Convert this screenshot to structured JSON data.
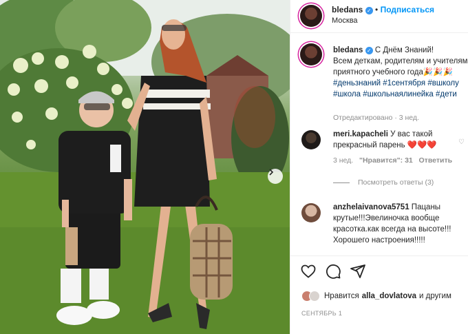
{
  "post": {
    "username": "bledans",
    "follow_label": "Подписаться",
    "dot": "•",
    "location": "Москва"
  },
  "caption": {
    "username": "bledans",
    "text_line1": "С Днём Знаний!",
    "text_rest": "Всем деткам, родителям и учителям приятного учебного года",
    "emoji": "🎉🎉🎉",
    "hashtags": [
      "#деньзнаний",
      "#1сентября",
      "#вшколу",
      "#школа",
      "#школьнаялинейка",
      "#дети"
    ],
    "edited": "Отредактировано",
    "time": "3 нед."
  },
  "comments": [
    {
      "username": "meri.kapacheli",
      "text": "У вас такой прекрасный парень",
      "emoji": "❤️❤️❤️",
      "time": "3 нед.",
      "likes": "\"Нравится\": 31",
      "reply": "Ответить"
    },
    {
      "username": "anzhelaivanova5751",
      "text": "Пацаны крутые!!!Эвелиночка вообще красотка.как всегда на высоте!!!Хорошего настроения!!!!!"
    }
  ],
  "view_replies": "Посмотреть ответы (3)",
  "likes_line": {
    "prefix": "Нравится",
    "user": "alla_dovlatova",
    "suffix": "и другим"
  },
  "date": "СЕНТЯБРЬ 1",
  "icons": {
    "like": "heart-icon",
    "comment": "comment-icon",
    "share": "paper-plane-icon",
    "next": "chevron-right-icon",
    "verified": "verified-badge-icon"
  },
  "colors": {
    "accent": "#0095f6",
    "hashtag": "#00376b",
    "muted": "#8e8e8e",
    "verified": "#3897f0"
  }
}
